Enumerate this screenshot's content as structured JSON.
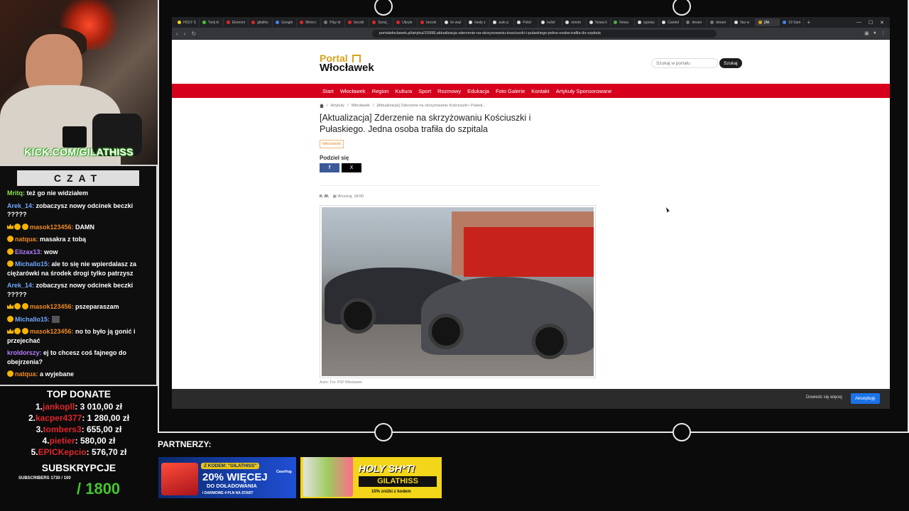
{
  "overlay": {
    "kick_link": "KICK.COM/GILATHISS",
    "chat_title": "CZAT",
    "chat_messages": [
      {
        "user": "Mritq:",
        "text": " też go nie widziałem",
        "color": "#8be04e",
        "badges": ""
      },
      {
        "user": "Arek_14:",
        "text": " zobaczysz nowy odcinek beczki ?????",
        "color": "#6fa8ff",
        "badges": ""
      },
      {
        "user": "masok123456:",
        "text": " DAMN",
        "color": "#f08a24",
        "badges": "crown"
      },
      {
        "user": "natqua:",
        "text": " masakra z tobą",
        "color": "#f08a24",
        "badges": "badge"
      },
      {
        "user": "Elizax13:",
        "text": " wow",
        "color": "#b47cff",
        "badges": "badge"
      },
      {
        "user": "Michallo15:",
        "text": " ale to się nie wpierdalasz za ciężarówki na środek drogi tylko patrzysz",
        "color": "#6fa8ff",
        "badges": "badge"
      },
      {
        "user": "Arek_14:",
        "text": " zobaczysz nowy odcinek beczki ?????",
        "color": "#6fa8ff",
        "badges": ""
      },
      {
        "user": "masok123456:",
        "text": " pszeparaszam",
        "color": "#f08a24",
        "badges": "crown"
      },
      {
        "user": "Michallo15:",
        "text": "",
        "color": "#6fa8ff",
        "badges": "badge-emote"
      },
      {
        "user": "masok123456:",
        "text": " no to było ją gonić i przejechać",
        "color": "#f08a24",
        "badges": "crown"
      },
      {
        "user": "kroldorszy:",
        "text": " ej to chcesz coś fajnego do obejrzenia?",
        "color": "#b47cff",
        "badges": ""
      },
      {
        "user": "natqua:",
        "text": " a wyjebane",
        "color": "#f08a24",
        "badges": "badge"
      }
    ],
    "top_donate_title": "TOP DONATE",
    "top_donate": [
      {
        "rank": "1.",
        "nick": "jankopll",
        "amount": ": 3 010,00 zł"
      },
      {
        "rank": "2.",
        "nick": "kacper4377",
        "amount": ": 1 280,00 zł"
      },
      {
        "rank": "3.",
        "nick": "tombers3",
        "amount": ": 655,00 zł"
      },
      {
        "rank": "4.",
        "nick": "pietier",
        "amount": ": 580,00 zł"
      },
      {
        "rank": "5.",
        "nick": "EPICKepcio",
        "amount": ": 576,70 zł"
      }
    ],
    "subs_title": "SUBSKRYPCJE",
    "subs_small": "SUBSCRIBERS 1730 / 100",
    "subs_goal": "/ 1800",
    "partners_title": "PARTNERZY:",
    "banner1": {
      "code": "Z KODEM: \"GILATHISS\"",
      "brand": "CaseHug",
      "big": "20% WIĘCEJ",
      "sub": "DO DOŁADOWANIA",
      "small": "I DARMOWE 4 PLN NA START"
    },
    "banner2": {
      "head": "HOLY SH*T!",
      "name": "GILATHISS",
      "off": "10% zniżki z kodem"
    }
  },
  "browser": {
    "tabs": [
      {
        "label": "HOLY S",
        "color": "#f3d51a"
      },
      {
        "label": "Twój ki",
        "color": "#44c72c"
      },
      {
        "label": "Ekonom",
        "color": "#e0252b"
      },
      {
        "label": "gilathis",
        "color": "#e0252b"
      },
      {
        "label": "Google",
        "color": "#4285f4"
      },
      {
        "label": "Minecr",
        "color": "#e0252b"
      },
      {
        "label": "Play dr",
        "color": "#777"
      },
      {
        "label": "beczki",
        "color": "#e0252b"
      },
      {
        "label": "Sorat_",
        "color": "#e0252b"
      },
      {
        "label": "Ukryte",
        "color": "#e0252b"
      },
      {
        "label": "beczki",
        "color": "#e0252b"
      },
      {
        "label": "ile waż",
        "color": "#ddd"
      },
      {
        "label": "kiedy z",
        "color": "#ddd"
      },
      {
        "label": "auto p",
        "color": "#ddd"
      },
      {
        "label": "Policl",
        "color": "#ddd"
      },
      {
        "label": "kolizt",
        "color": "#ddd"
      },
      {
        "label": "omoto",
        "color": "#ddd"
      },
      {
        "label": "Nowa k",
        "color": "#ddd"
      },
      {
        "label": "Rewa",
        "color": "#4caf50"
      },
      {
        "label": "typowy",
        "color": "#ddd"
      },
      {
        "label": "Candel",
        "color": "#ddd"
      },
      {
        "label": "dream",
        "color": "#777"
      },
      {
        "label": "dream",
        "color": "#777"
      },
      {
        "label": "Ilao w",
        "color": "#ddd"
      },
      {
        "label": "[Ak",
        "color": "#d8a21b",
        "active": true
      },
      {
        "label": "19 Sam",
        "color": "#4285f4"
      }
    ],
    "url": "portalwloclawek.pl/artykul/15998,aktualizacja-zderzenie-na-skrzyzowaniu-kosciuszki-i-pulaskiego-jedna-osoba-trafila-do-szpitala"
  },
  "site": {
    "logo_top": "Portal",
    "logo_bottom": "Włocławek",
    "search_placeholder": "Szukaj w portalu",
    "search_button": "Szukaj",
    "nav": [
      "Start",
      "Włocławek",
      "Region",
      "Kultura",
      "Sport",
      "Rozmowy",
      "Edukacja",
      "Foto Galerie",
      "Kontakt",
      "Artykuły Sponsorowane"
    ],
    "breadcrumb": [
      "Artykuły",
      "Włocławek",
      "[Aktualizacja] Zderzenie na skrzyżowaniu Kościuszki i Pułask..."
    ],
    "breadcrumb_sep": "/",
    "title": "[Aktualizacja] Zderzenie na skrzyżowaniu Kościuszki i Pułaskiego. Jedna osoba trafiła do szpitala",
    "category": "Włocławek",
    "share_label": "Podziel się",
    "share_fb": "f",
    "share_x": "X",
    "author": "K. M.",
    "date": "Wczoraj, 18:00",
    "photo_caption": "Autor: Fot. PSP Włocławek",
    "cookie_more": "Dowiedz się więcej",
    "cookie_accept": "Akceptuję"
  }
}
